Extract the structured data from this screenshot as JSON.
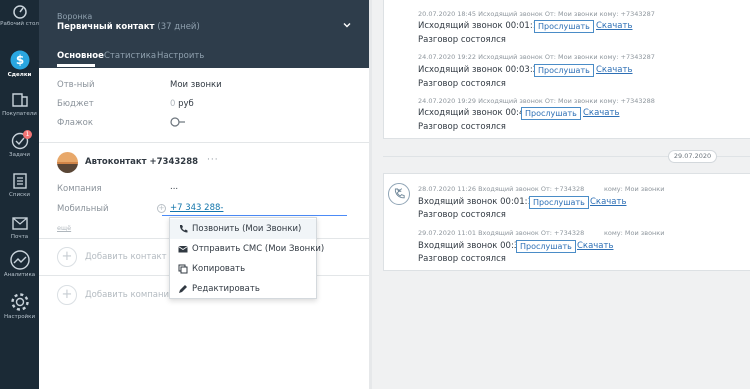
{
  "nav": [
    {
      "key": "desk",
      "label": "Рабочий стол"
    },
    {
      "key": "deals",
      "label": "Сделки"
    },
    {
      "key": "buyers",
      "label": "Покупатели"
    },
    {
      "key": "tasks",
      "label": "Задачи",
      "badge": "1"
    },
    {
      "key": "lists",
      "label": "Списки"
    },
    {
      "key": "mail",
      "label": "Почта"
    },
    {
      "key": "analytics",
      "label": "Аналитика"
    },
    {
      "key": "settings",
      "label": "Настройки"
    }
  ],
  "card": {
    "pipeline_label": "Воронка",
    "stage": "Первичный контакт",
    "stage_days": "(37 дней)",
    "tabs": [
      "Основное",
      "Статистика",
      "Настроить"
    ],
    "fields": [
      {
        "label": "Отв-ный",
        "value": "Мои звонки"
      },
      {
        "label": "Бюджет",
        "value_prefix": "0",
        "value": "руб"
      },
      {
        "label": "Флажок",
        "value": ""
      }
    ],
    "contact": {
      "name": "Автоконтакт +7343288",
      "dots": "···",
      "company_label": "Компания",
      "company_value": "...",
      "mobile_label": "Мобильный",
      "phone": "+7 343 288-",
      "more": "ещё"
    },
    "add_contact": "Добавить контакт",
    "add_company": "Добавить компанию"
  },
  "context_menu": [
    {
      "icon": "phone-icon",
      "label": "Позвонить (Мои Звонки)"
    },
    {
      "icon": "envelope-icon",
      "label": "Отправить СМС (Мои Звонки)"
    },
    {
      "icon": "copy-icon",
      "label": "Копировать"
    },
    {
      "icon": "pencil-icon",
      "label": "Редактировать"
    }
  ],
  "feed": {
    "top_note": {
      "entries": [
        {
          "meta": "20.07.2020 18:45 Исходящий звонок От: Мои звонки кому: +7343287",
          "line": "Исходящий звонок 00:01:12",
          "status": "Разговор состоялся"
        },
        {
          "meta": "24.07.2020 19:22 Исходящий звонок От: Мои звонки кому: +7343287",
          "line": "Исходящий звонок 00:03:22",
          "status": "Разговор состоялся"
        },
        {
          "meta": "24.07.2020 19:29 Исходящий звонок От: Мои звонки кому: +7343288",
          "line": "Исходящий звонок 00:47",
          "status": "Разговор состоялся"
        }
      ]
    },
    "date": "29.07.2020",
    "bottom_note": {
      "entries": [
        {
          "meta": "28.07.2020 11:26 Входящий звонок От: +734328",
          "meta_to": "кому: Мои звонки",
          "line": "Входящий звонок 00:01:13",
          "status": "Разговор состоялся"
        },
        {
          "meta": "29.07.2020 11:01 Входящий звонок От: +734328",
          "meta_to": "кому: Мои звонки",
          "line": "Входящий звонок 00:35",
          "status": "Разговор состоялся"
        }
      ]
    },
    "listen_label": "Прослушать",
    "download_label": "Скачать"
  }
}
